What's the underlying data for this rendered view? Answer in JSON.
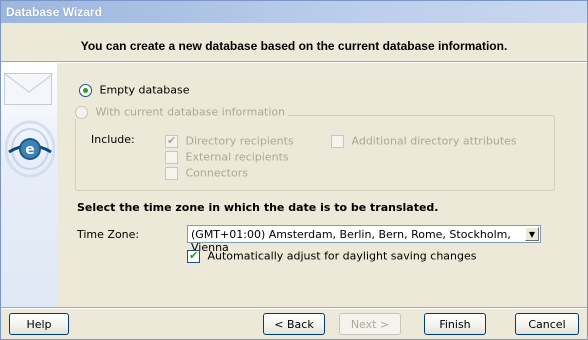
{
  "window": {
    "title": "Database Wizard",
    "header": "You can create a new database based on the current database information."
  },
  "options": {
    "empty_db": {
      "label": "Empty database",
      "selected": true
    },
    "current_db": {
      "label": "With current database information",
      "selected": false,
      "enabled": false
    }
  },
  "include": {
    "label": "Include:",
    "items": [
      {
        "label": "Directory recipients",
        "checked": true,
        "enabled": false
      },
      {
        "label": "External recipients",
        "checked": false,
        "enabled": false
      },
      {
        "label": "Connectors",
        "checked": false,
        "enabled": false
      },
      {
        "label": "Additional directory attributes",
        "checked": false,
        "enabled": false
      }
    ]
  },
  "timezone": {
    "heading": "Select the time zone in which the date is to be translated.",
    "label": "Time Zone:",
    "selected": "(GMT+01:00) Amsterdam, Berlin, Bern, Rome, Stockholm, Vienna",
    "dst_label": "Automatically adjust for daylight saving changes",
    "dst_checked": true
  },
  "buttons": {
    "help": "Help",
    "back": "< Back",
    "next": "Next >",
    "finish": "Finish",
    "cancel": "Cancel"
  },
  "icons": [
    "envelope-icon",
    "globe-logo-icon"
  ]
}
